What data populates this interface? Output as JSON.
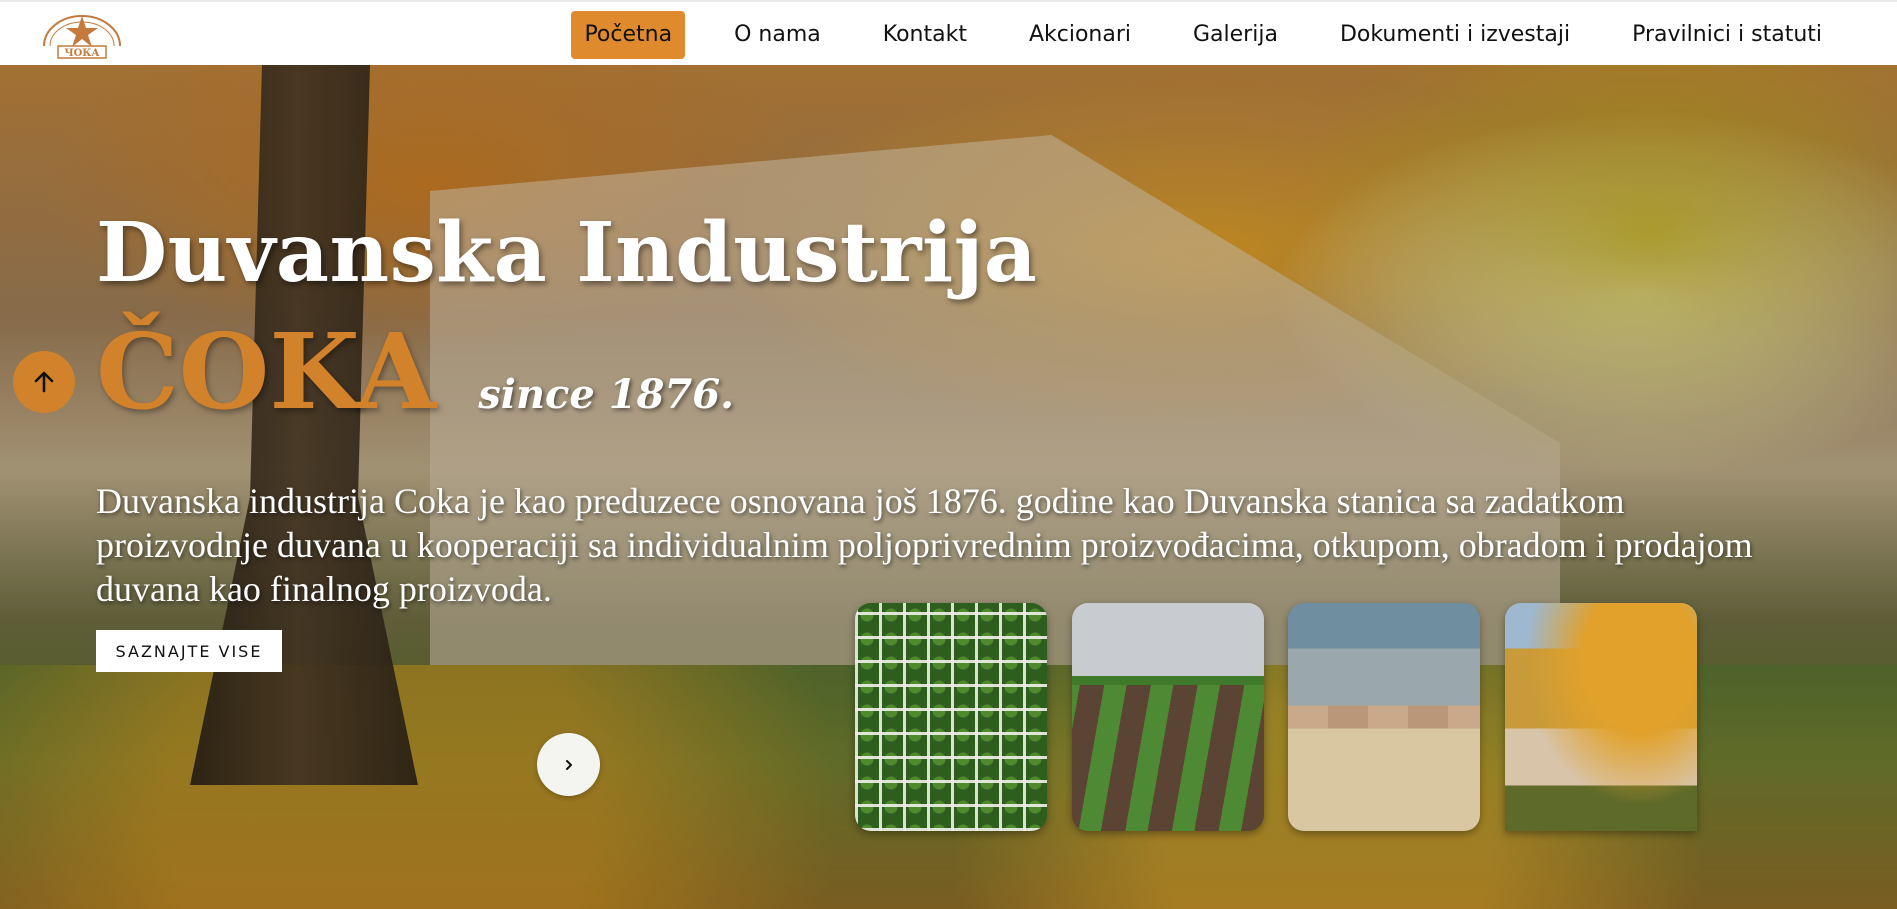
{
  "logo": {
    "alt_text": "Duvanska industrija Čoka",
    "icon": "logo-emblem"
  },
  "nav": {
    "items": [
      {
        "label": "Početna",
        "active": true
      },
      {
        "label": "O nama"
      },
      {
        "label": "Kontakt"
      },
      {
        "label": "Akcionari"
      },
      {
        "label": "Galerija"
      },
      {
        "label": "Dokumenti i izvestaji"
      },
      {
        "label": "Pravilnici i statuti"
      }
    ],
    "active_color": "#e08a2e"
  },
  "hero": {
    "title": "Duvanska Industrija",
    "brand": "ČOKA",
    "since": "since 1876.",
    "description": "Duvanska industrija Coka je kao preduzece osnovana još 1876. godine kao Duvanska stanica sa zadatkom proizvodnje duvana u kooperaciji sa individualnim poljoprivrednim proizvođacima, otkupom, obradom i prodajom duvana kao finalnog proizvoda.",
    "cta_label": "SAZNAJTE VISE",
    "brand_color": "#d2822a"
  },
  "controls": {
    "scroll_top_icon": "arrow-up-icon",
    "next_icon": "chevron-right-icon"
  },
  "thumbnails": [
    {
      "subject": "seedling-trays"
    },
    {
      "subject": "tobacco-field"
    },
    {
      "subject": "factory-interior"
    },
    {
      "subject": "building-autumn"
    }
  ]
}
